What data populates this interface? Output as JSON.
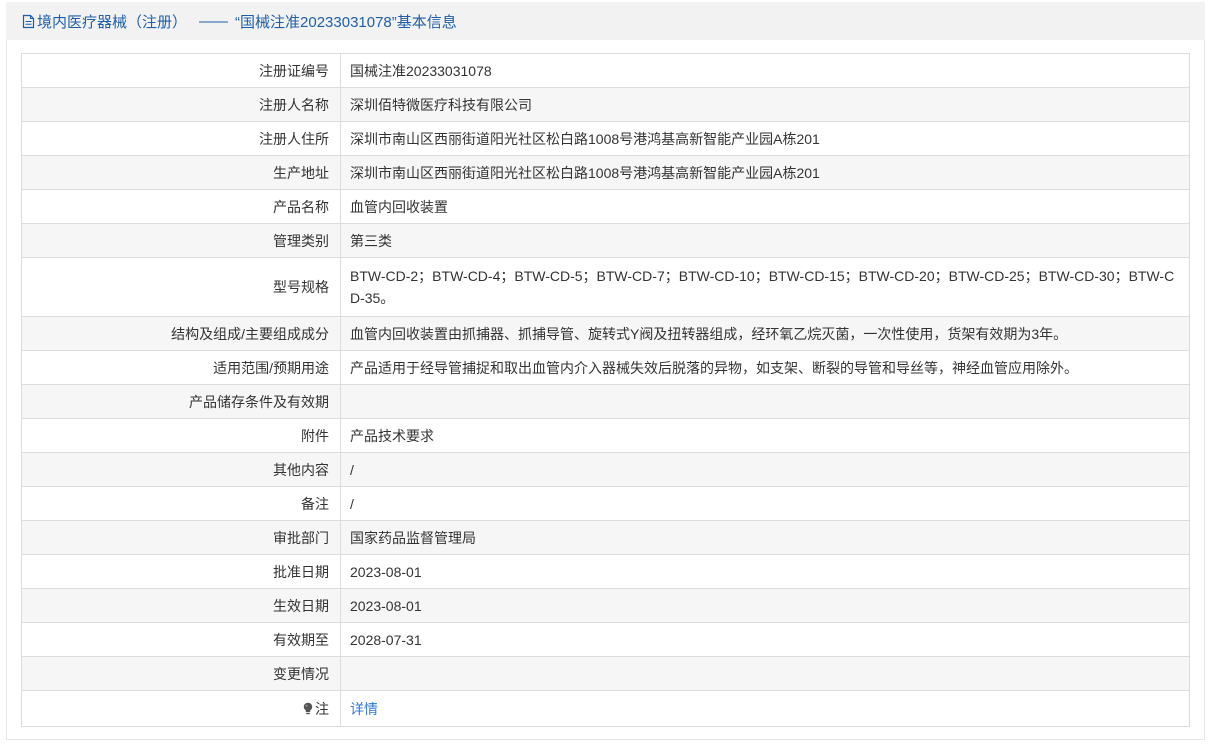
{
  "header": {
    "icon": "document-icon",
    "category": "境内医疗器械（注册）",
    "dash": "——",
    "title": "“国械注准20233031078”基本信息"
  },
  "rows": [
    {
      "label": "注册证编号",
      "value": "国械注准20233031078"
    },
    {
      "label": "注册人名称",
      "value": "深圳佰特微医疗科技有限公司"
    },
    {
      "label": "注册人住所",
      "value": "深圳市南山区西丽街道阳光社区松白路1008号港鸿基高新智能产业园A栋201"
    },
    {
      "label": "生产地址",
      "value": "深圳市南山区西丽街道阳光社区松白路1008号港鸿基高新智能产业园A栋201"
    },
    {
      "label": "产品名称",
      "value": "血管内回收装置"
    },
    {
      "label": "管理类别",
      "value": "第三类"
    },
    {
      "label": "型号规格",
      "value": "BTW-CD-2；BTW-CD-4；BTW-CD-5；BTW-CD-7；BTW-CD-10；BTW-CD-15；BTW-CD-20；BTW-CD-25；BTW-CD-30；BTW-CD-35。"
    },
    {
      "label": "结构及组成/主要组成成分",
      "value": "血管内回收装置由抓捕器、抓捕导管、旋转式Y阀及扭转器组成，经环氧乙烷灭菌，一次性使用，货架有效期为3年。"
    },
    {
      "label": "适用范围/预期用途",
      "value": "产品适用于经导管捕捉和取出血管内介入器械失效后脱落的异物，如支架、断裂的导管和导丝等，神经血管应用除外。"
    },
    {
      "label": "产品储存条件及有效期",
      "value": ""
    },
    {
      "label": "附件",
      "value": "产品技术要求"
    },
    {
      "label": "其他内容",
      "value": "/"
    },
    {
      "label": "备注",
      "value": "/"
    },
    {
      "label": "审批部门",
      "value": "国家药品监督管理局"
    },
    {
      "label": "批准日期",
      "value": "2023-08-01"
    },
    {
      "label": "生效日期",
      "value": "2023-08-01"
    },
    {
      "label": "有效期至",
      "value": "2028-07-31"
    },
    {
      "label": "变更情况",
      "value": ""
    }
  ],
  "note": {
    "icon": "bulb-icon",
    "label": "注",
    "link": "详情"
  },
  "colors": {
    "accent": "#1f5fa8",
    "link": "#2d7bd1",
    "stripe": "#f6f6f6",
    "border": "#dcdcdc",
    "text": "#333333",
    "header_bg": "#f2f2f2"
  }
}
